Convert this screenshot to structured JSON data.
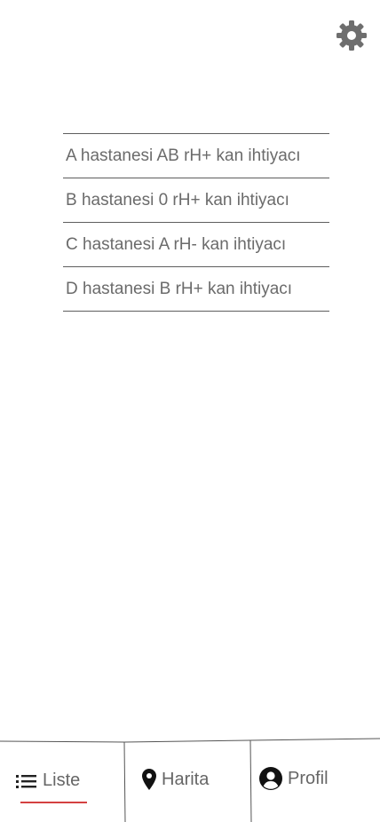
{
  "header": {
    "settings_icon": "gear-icon"
  },
  "requests": [
    {
      "label": "A hastanesi AB rH+ kan ihtiyacı"
    },
    {
      "label": "B hastanesi 0 rH+ kan ihtiyacı"
    },
    {
      "label": "C hastanesi A rH- kan ihtiyacı"
    },
    {
      "label": "D hastanesi B rH+ kan ihtiyacı"
    }
  ],
  "nav": {
    "items": [
      {
        "label": "Liste",
        "icon": "list-icon",
        "active": true
      },
      {
        "label": "Harita",
        "icon": "map-pin-icon",
        "active": false
      },
      {
        "label": "Profil",
        "icon": "user-circle-icon",
        "active": false
      }
    ],
    "active_color": "#d44141"
  }
}
